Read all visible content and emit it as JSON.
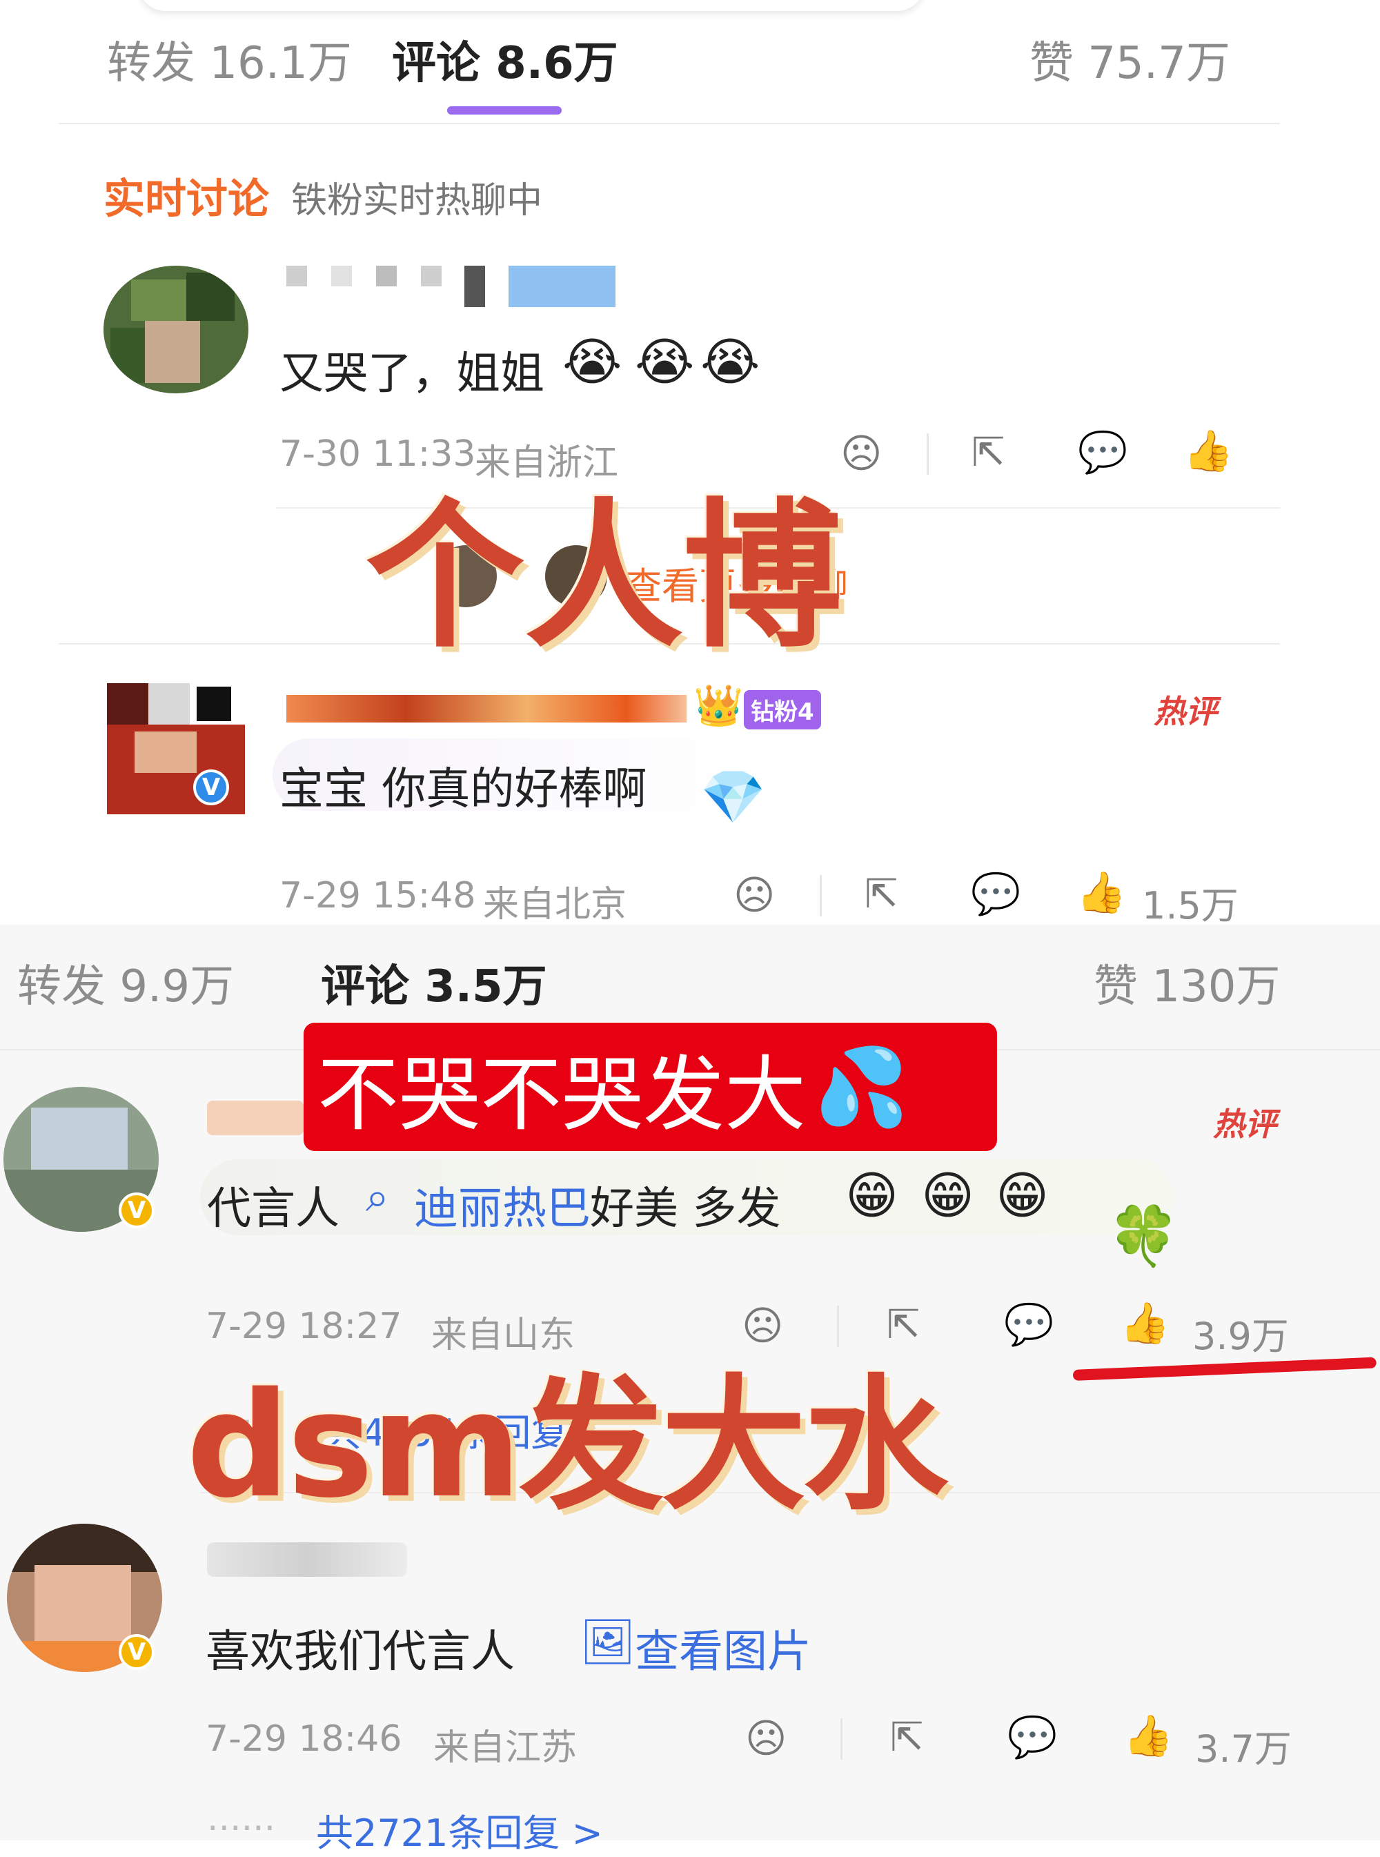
{
  "top_tabs": {
    "repost": "转发 16.1万",
    "comments": "评论 8.6万",
    "likes": "赞 75.7万"
  },
  "realtime": {
    "title": "实时讨论",
    "subtitle": "铁粉实时热聊中"
  },
  "comment1": {
    "text": "又哭了，姐姐",
    "emojis": [
      "😭",
      "😭",
      "😭"
    ],
    "time": "7-30 11:33",
    "location": "来自浙江"
  },
  "hot_chat_link": "查看更多热聊",
  "comment2": {
    "fan_badge": "钻粉4",
    "hot_label": "热评",
    "text": "宝宝 你真的好棒啊",
    "time": "7-29 15:48",
    "location": "来自北京",
    "likes": "1.5万"
  },
  "second_tabs": {
    "repost": "转发 9.9万",
    "comments": "评论 3.5万",
    "likes": "赞 130万"
  },
  "comment3": {
    "hot_label": "热评",
    "prefix": "代言人",
    "link": "迪丽热巴",
    "suffix": "好美 多发",
    "emojis": [
      "😁",
      "😁",
      "😁"
    ],
    "time": "7-29 18:27",
    "location": "来自山东",
    "likes": "3.9万",
    "replies": "共4554条回复 >"
  },
  "comment4": {
    "text": "喜欢我们代言人",
    "image_link": "查看图片",
    "time": "7-29 18:46",
    "location": "来自江苏",
    "likes": "3.7万",
    "replies": "共2721条回复 >"
  },
  "overlays": {
    "banner_text": "不哭不哭发大",
    "overlay_top": "个人博",
    "overlay_bottom": "dsm发大水"
  },
  "icons": {
    "dislike": "sad-face-icon",
    "share": "share-icon",
    "comment": "comment-icon",
    "like": "thumbs-up-icon"
  },
  "colors": {
    "accent_purple": "#9b6cf0",
    "realtime_orange": "#f26a2a",
    "hot_red": "#e0423c",
    "link_blue": "#3b6fe0"
  }
}
